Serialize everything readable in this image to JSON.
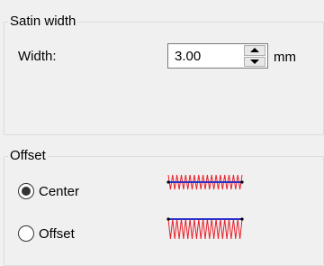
{
  "satin_width": {
    "group_title": "Satin width",
    "width_label": "Width:",
    "width_value": "3.00",
    "unit": "mm"
  },
  "offset": {
    "group_title": "Offset",
    "options": [
      {
        "label": "Center",
        "selected": true
      },
      {
        "label": "Offset",
        "selected": false
      }
    ]
  },
  "colors": {
    "stitch": "#e8202a",
    "baseline": "#2a2fc8"
  }
}
